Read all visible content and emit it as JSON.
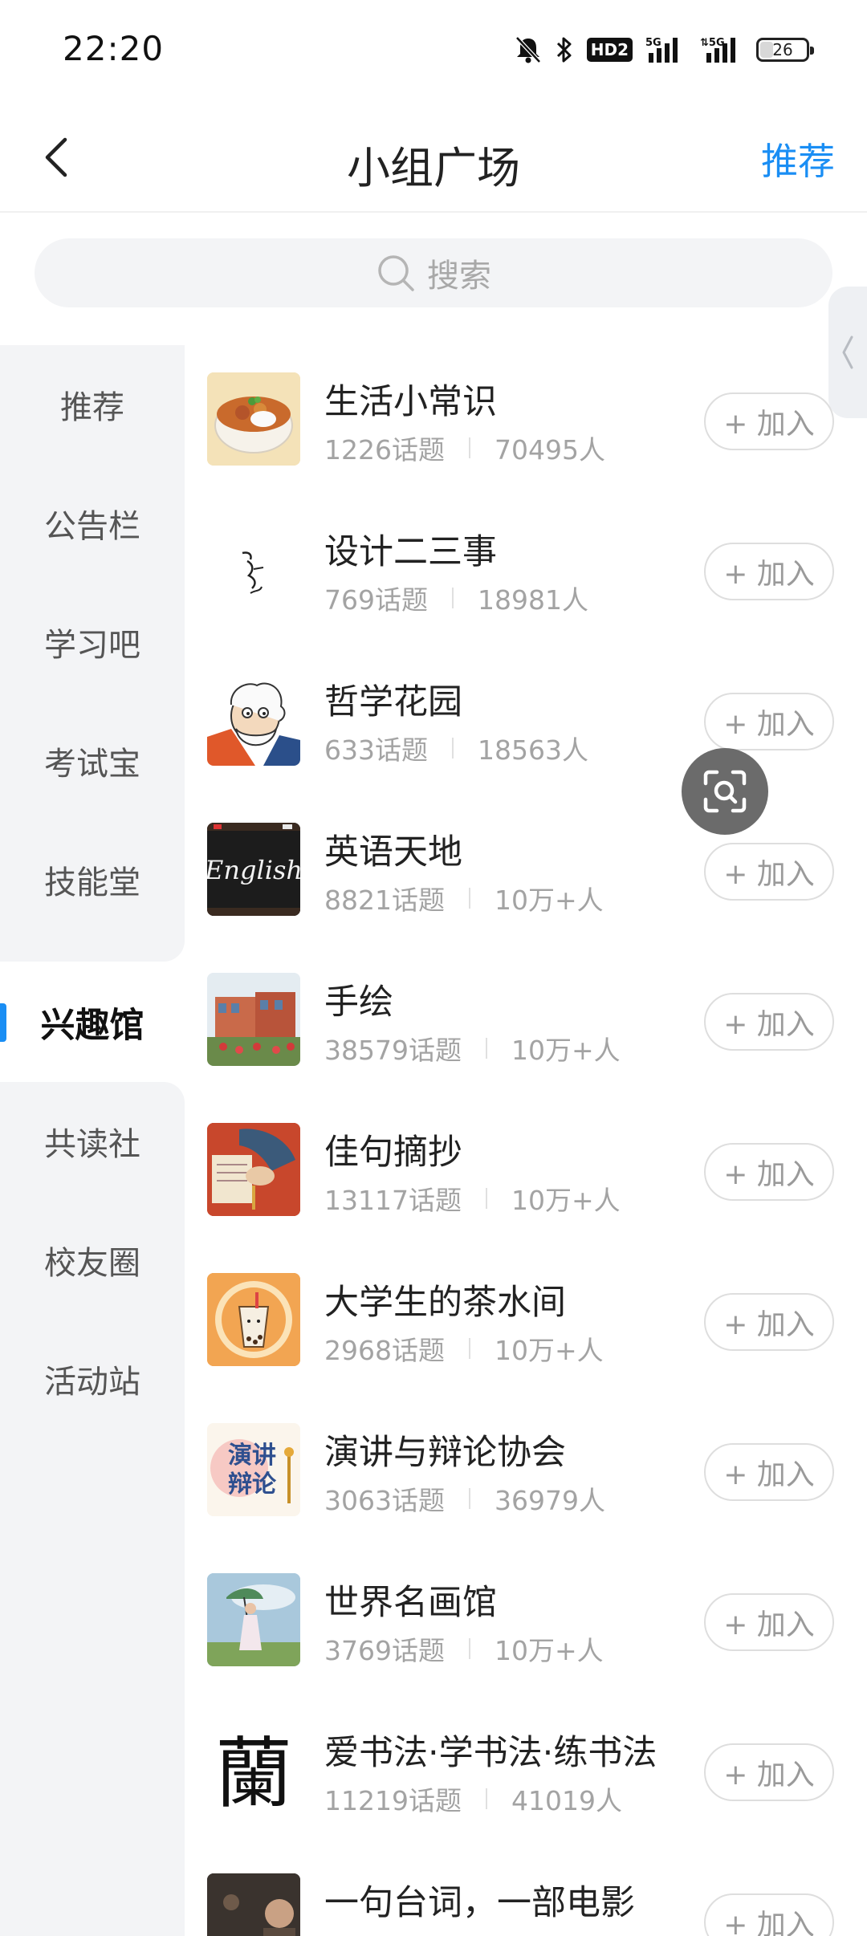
{
  "status_bar": {
    "time": "22:20",
    "hd_label": "HD2",
    "network_1": "5G",
    "network_2": "5G",
    "battery_level": "26",
    "icons": [
      "mute-bell-icon",
      "bluetooth-icon",
      "hd-voice-icon",
      "signal-5g-icon",
      "signal-5g-icon",
      "battery-icon"
    ]
  },
  "header": {
    "title": "小组广场",
    "recommend_label": "推荐",
    "back_icon": "chevron-left-icon"
  },
  "search": {
    "placeholder": "搜索",
    "icon": "search-icon"
  },
  "sidebar": {
    "active_index": 5,
    "items": [
      {
        "label": "推荐"
      },
      {
        "label": "公告栏"
      },
      {
        "label": "学习吧"
      },
      {
        "label": "考试宝"
      },
      {
        "label": "技能堂"
      },
      {
        "label": "兴趣馆"
      },
      {
        "label": "共读社"
      },
      {
        "label": "校友圈"
      },
      {
        "label": "活动站"
      }
    ]
  },
  "groups": [
    {
      "name": "生活小常识",
      "topics": "1226话题",
      "members": "70495人",
      "join_label": "+ 加入",
      "thumb": "food-bowl-image"
    },
    {
      "name": "设计二三事",
      "topics": "769话题",
      "members": "18981人",
      "join_label": "+ 加入",
      "thumb": "sketch-face-image"
    },
    {
      "name": "哲学花园",
      "topics": "633话题",
      "members": "18563人",
      "join_label": "+ 加入",
      "thumb": "philosopher-cartoon-image"
    },
    {
      "name": "英语天地",
      "topics": "8821话题",
      "members": "10万+人",
      "join_label": "+ 加入",
      "thumb": "english-chalkboard-image",
      "thumb_text": "English"
    },
    {
      "name": "手绘",
      "topics": "38579话题",
      "members": "10万+人",
      "join_label": "+ 加入",
      "thumb": "painted-building-image"
    },
    {
      "name": "佳句摘抄",
      "topics": "13117话题",
      "members": "10万+人",
      "join_label": "+ 加入",
      "thumb": "writing-hand-image"
    },
    {
      "name": "大学生的茶水间",
      "topics": "2968话题",
      "members": "10万+人",
      "join_label": "+ 加入",
      "thumb": "milk-tea-image"
    },
    {
      "name": "演讲与辩论协会",
      "topics": "3063话题",
      "members": "36979人",
      "join_label": "+ 加入",
      "thumb": "speech-debate-logo",
      "thumb_text_1": "演讲",
      "thumb_text_2": "辩论"
    },
    {
      "name": "世界名画馆",
      "topics": "3769话题",
      "members": "10万+人",
      "join_label": "+ 加入",
      "thumb": "monet-painting-image"
    },
    {
      "name": "爱书法·学书法·练书法",
      "topics": "11219话题",
      "members": "41019人",
      "join_label": "+ 加入",
      "thumb": "calligraphy-image",
      "thumb_text": "蘭"
    },
    {
      "name": "一句台词，一部电影",
      "topics": "",
      "members": "",
      "join_label": "+ 加入",
      "thumb": "movie-still-image"
    }
  ],
  "floating_button": {
    "icon": "scan-search-icon"
  },
  "colors": {
    "accent": "#1a8ef4",
    "sidebar_bg": "#f3f4f6",
    "muted_text": "#a3a3a3"
  }
}
